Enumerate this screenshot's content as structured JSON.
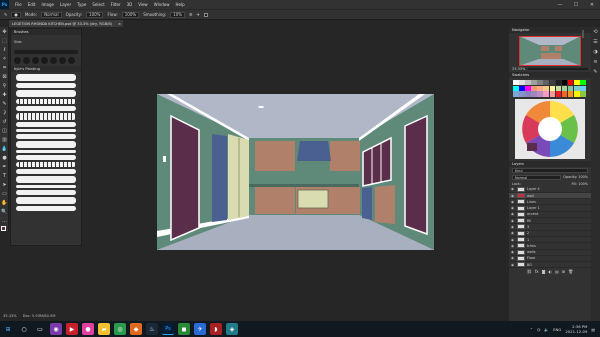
{
  "app": {
    "logo": "Ps",
    "menu": [
      "File",
      "Edit",
      "Image",
      "Layer",
      "Type",
      "Select",
      "Filter",
      "3D",
      "View",
      "Window",
      "Help"
    ],
    "window_controls": [
      "—",
      "☐",
      "✕"
    ]
  },
  "options_bar": {
    "mode_label": "Mode:",
    "mode_value": "Normal",
    "opacity_label": "Opacity:",
    "opacity_value": "100%",
    "flow_label": "Flow:",
    "flow_value": "100%",
    "smoothing_label": "Smoothing:",
    "smoothing_value": "10%"
  },
  "document": {
    "tab_title": "LEGETION RHONDA KITCHEN.psd @ 33.3% (dry, RGB/8)",
    "close": "×",
    "zoom": "33.33%",
    "doc_size": "Doc: 5.93M/80.5M"
  },
  "brushes_panel": {
    "title": "Brushes",
    "size_label": "Size:",
    "folder": "Kyle's Painting"
  },
  "navigator": {
    "title": "Navigator",
    "zoom": "33.33%"
  },
  "swatches": {
    "title": "Swatches",
    "colors": [
      "#ffffff",
      "#e0e0e0",
      "#c0c0c0",
      "#a0a0a0",
      "#808080",
      "#606060",
      "#404040",
      "#202020",
      "#000000",
      "#ff0000",
      "#ffff00",
      "#00ff00",
      "#00ffff",
      "#0000ff",
      "#ff00ff",
      "#f7977a",
      "#f9ad81",
      "#fdc68a",
      "#fff79a",
      "#c4df9b",
      "#a2d39c",
      "#82ca9d",
      "#7bcdc8",
      "#6ecff6",
      "#7ea7d8",
      "#8493ca",
      "#8882be",
      "#a187be",
      "#bc8dbf",
      "#f49ac2",
      "#f6989d",
      "#ed1c24",
      "#f26522",
      "#f7941d",
      "#fff200",
      "#8dc63f"
    ]
  },
  "layers_panel": {
    "title": "Layers",
    "kind": "Kind",
    "blend": "Normal",
    "opacity": "Opacity: 100%",
    "lock": "Lock:",
    "fill": "Fill: 100%",
    "layers": [
      {
        "name": "Layer 4",
        "active": false
      },
      {
        "name": "wall",
        "active": true
      },
      {
        "name": "Lines",
        "active": false
      },
      {
        "name": "Layer 1",
        "active": false
      },
      {
        "name": "accent",
        "active": false
      },
      {
        "name": "fill",
        "active": false
      },
      {
        "name": "3",
        "active": false
      },
      {
        "name": "2",
        "active": false
      },
      {
        "name": "1",
        "active": false
      },
      {
        "name": "trims",
        "active": false
      },
      {
        "name": "walls",
        "active": false
      },
      {
        "name": "Floor",
        "active": false
      },
      {
        "name": "BG",
        "active": false
      }
    ]
  },
  "taskbar": {
    "time": "2:36 PM",
    "date": "2021-12-09",
    "lang": "ENG"
  },
  "colors": {
    "wall_green": "#5f8a7a",
    "cabinet_brown": "#b0806a",
    "door_purple": "#5a2d4a",
    "floor": "#a8b0c0",
    "ceiling": "#b0b8c8",
    "blue": "#4a6090",
    "cream": "#d8dcb0"
  }
}
